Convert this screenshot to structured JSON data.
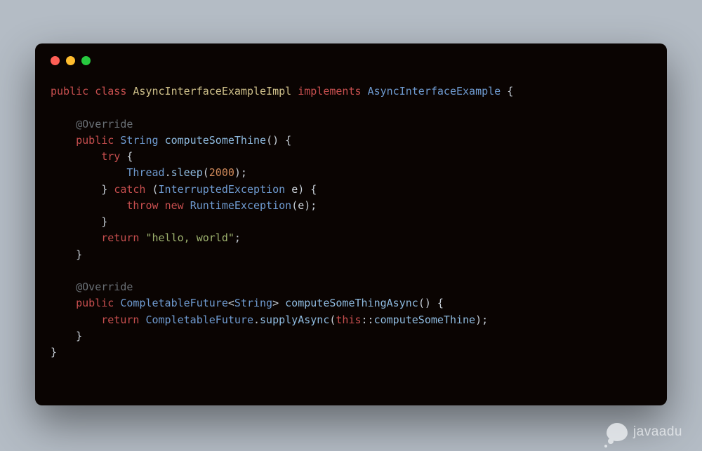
{
  "watermark": {
    "label": "javaadu"
  },
  "code": {
    "lines": [
      [
        {
          "c": "kw",
          "t": "public"
        },
        {
          "c": "pun",
          "t": " "
        },
        {
          "c": "kw",
          "t": "class"
        },
        {
          "c": "pun",
          "t": " "
        },
        {
          "c": "name",
          "t": "AsyncInterfaceExampleImpl"
        },
        {
          "c": "pun",
          "t": " "
        },
        {
          "c": "kw",
          "t": "implements"
        },
        {
          "c": "pun",
          "t": " "
        },
        {
          "c": "type",
          "t": "AsyncInterfaceExample"
        },
        {
          "c": "pun",
          "t": " {"
        }
      ],
      [],
      [
        {
          "c": "pun",
          "t": "    "
        },
        {
          "c": "ann",
          "t": "@Override"
        }
      ],
      [
        {
          "c": "pun",
          "t": "    "
        },
        {
          "c": "kw",
          "t": "public"
        },
        {
          "c": "pun",
          "t": " "
        },
        {
          "c": "type",
          "t": "String"
        },
        {
          "c": "pun",
          "t": " "
        },
        {
          "c": "mtd",
          "t": "computeSomeThine"
        },
        {
          "c": "pun",
          "t": "() {"
        }
      ],
      [
        {
          "c": "pun",
          "t": "        "
        },
        {
          "c": "kw",
          "t": "try"
        },
        {
          "c": "pun",
          "t": " {"
        }
      ],
      [
        {
          "c": "pun",
          "t": "            "
        },
        {
          "c": "type",
          "t": "Thread"
        },
        {
          "c": "pun",
          "t": "."
        },
        {
          "c": "mtd",
          "t": "sleep"
        },
        {
          "c": "pun",
          "t": "("
        },
        {
          "c": "num",
          "t": "2000"
        },
        {
          "c": "pun",
          "t": ");"
        }
      ],
      [
        {
          "c": "pun",
          "t": "        } "
        },
        {
          "c": "kw",
          "t": "catch"
        },
        {
          "c": "pun",
          "t": " ("
        },
        {
          "c": "type",
          "t": "InterruptedException"
        },
        {
          "c": "pun",
          "t": " "
        },
        {
          "c": "id",
          "t": "e"
        },
        {
          "c": "pun",
          "t": ") {"
        }
      ],
      [
        {
          "c": "pun",
          "t": "            "
        },
        {
          "c": "kw",
          "t": "throw"
        },
        {
          "c": "pun",
          "t": " "
        },
        {
          "c": "kw",
          "t": "new"
        },
        {
          "c": "pun",
          "t": " "
        },
        {
          "c": "type",
          "t": "RuntimeException"
        },
        {
          "c": "pun",
          "t": "("
        },
        {
          "c": "id",
          "t": "e"
        },
        {
          "c": "pun",
          "t": ");"
        }
      ],
      [
        {
          "c": "pun",
          "t": "        }"
        }
      ],
      [
        {
          "c": "pun",
          "t": "        "
        },
        {
          "c": "kw",
          "t": "return"
        },
        {
          "c": "pun",
          "t": " "
        },
        {
          "c": "str",
          "t": "\"hello, world\""
        },
        {
          "c": "pun",
          "t": ";"
        }
      ],
      [
        {
          "c": "pun",
          "t": "    }"
        }
      ],
      [],
      [
        {
          "c": "pun",
          "t": "    "
        },
        {
          "c": "ann",
          "t": "@Override"
        }
      ],
      [
        {
          "c": "pun",
          "t": "    "
        },
        {
          "c": "kw",
          "t": "public"
        },
        {
          "c": "pun",
          "t": " "
        },
        {
          "c": "type",
          "t": "CompletableFuture"
        },
        {
          "c": "pun",
          "t": "<"
        },
        {
          "c": "type",
          "t": "String"
        },
        {
          "c": "pun",
          "t": "> "
        },
        {
          "c": "mtd",
          "t": "computeSomeThingAsync"
        },
        {
          "c": "pun",
          "t": "() {"
        }
      ],
      [
        {
          "c": "pun",
          "t": "        "
        },
        {
          "c": "kw",
          "t": "return"
        },
        {
          "c": "pun",
          "t": " "
        },
        {
          "c": "type",
          "t": "CompletableFuture"
        },
        {
          "c": "pun",
          "t": "."
        },
        {
          "c": "mtd",
          "t": "supplyAsync"
        },
        {
          "c": "pun",
          "t": "("
        },
        {
          "c": "this",
          "t": "this"
        },
        {
          "c": "pun",
          "t": "::"
        },
        {
          "c": "mtd",
          "t": "computeSomeThine"
        },
        {
          "c": "pun",
          "t": ");"
        }
      ],
      [
        {
          "c": "pun",
          "t": "    }"
        }
      ],
      [
        {
          "c": "pun",
          "t": "}"
        }
      ]
    ]
  }
}
